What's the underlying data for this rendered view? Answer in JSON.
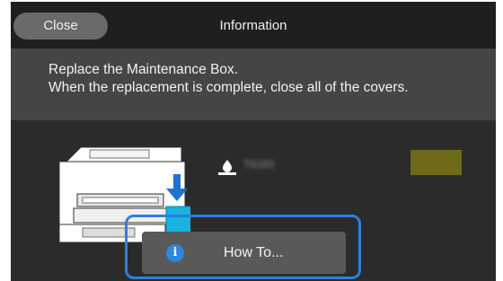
{
  "header": {
    "close_label": "Close",
    "title": "Information"
  },
  "message": {
    "line1": "Replace the Maintenance Box.",
    "line2": "When the replacement is complete, close all of the covers."
  },
  "status": {
    "printer_icon": "printer-with-maintenance-box-icon",
    "ink_icon": "ink-drop-icon",
    "ink_name": "T6193",
    "level_color": "#6e6a18"
  },
  "footer": {
    "howto_label": "How To...",
    "howto_icon": "info-icon",
    "highlight_color": "#2f7fdd"
  }
}
